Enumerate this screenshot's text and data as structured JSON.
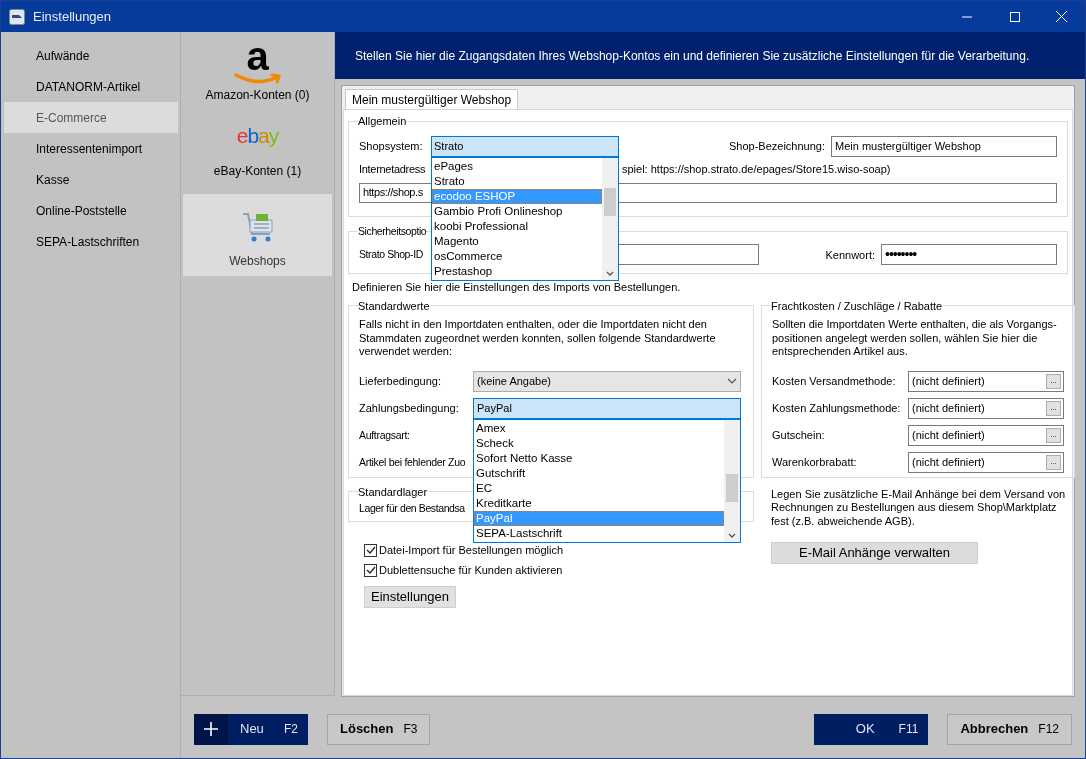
{
  "window": {
    "title": "Einstellungen"
  },
  "sidebar": {
    "items": [
      {
        "label": "Aufwände",
        "selected": false
      },
      {
        "label": "DATANORM-Artikel",
        "selected": false
      },
      {
        "label": "E-Commerce",
        "selected": true
      },
      {
        "label": "Interessentenimport",
        "selected": false
      },
      {
        "label": "Kasse",
        "selected": false
      },
      {
        "label": "Online-Poststelle",
        "selected": false
      },
      {
        "label": "SEPA-Lastschriften",
        "selected": false
      }
    ]
  },
  "accounts": [
    {
      "kind": "amazon",
      "logo": "a",
      "label": "Amazon-Konten (0)",
      "selected": false
    },
    {
      "kind": "ebay",
      "logo": "ebay",
      "label": "eBay-Konten (1)",
      "selected": false
    },
    {
      "kind": "webshop",
      "label": "Webshops",
      "selected": true
    }
  ],
  "header": "Stellen Sie hier die Zugangsdaten Ihres Webshop-Kontos ein und definieren Sie zusätzliche Einstellungen für die Verarbeitung.",
  "tabs": [
    {
      "label": "Mein mustergültiger Webshop",
      "selected": true
    }
  ],
  "general": {
    "legend": "Allgemein",
    "shopsystem_label": "Shopsystem:",
    "shopsystem_value": "Strato",
    "shopsystem_options": [
      {
        "label": "ePages",
        "selected": false
      },
      {
        "label": "Strato",
        "selected": false
      },
      {
        "label": "ecodoo ESHOP",
        "selected": true
      },
      {
        "label": "Gambio Profi Onlineshop",
        "selected": false
      },
      {
        "label": "koobi Professional",
        "selected": false
      },
      {
        "label": "Magento",
        "selected": false
      },
      {
        "label": "osCommerce",
        "selected": false
      },
      {
        "label": "Prestashop",
        "selected": false
      }
    ],
    "name_label": "Shop-Bezeichnung:",
    "name_value": "Mein mustergültiger Webshop",
    "url_label": "Internetadress",
    "url_hint": "spiel: https://shop.strato.de/epages/Store15.wiso-soap)",
    "url_value": "https://shop.s"
  },
  "security": {
    "legend": "Sicherheitsoptio",
    "id_label": "Strato Shop-ID",
    "password_label": "Kennwort:",
    "password_mask": "••••••••"
  },
  "import_note": "Definieren Sie hier die Einstellungen des Imports von Bestellungen.",
  "defaults": {
    "legend": "Standardwerte",
    "description": "Falls nicht in den Importdaten enthalten, oder die Importdaten nicht den Stammdaten zugeordnet werden konnten, sollen folgende Standardwerte verwendet werden:",
    "rows": [
      {
        "kind": "select",
        "label": "Lieferbedingung:",
        "value": "(keine Angabe)"
      },
      {
        "kind": "dropdown",
        "label": "Zahlungsbedingung:",
        "value": "PayPal",
        "options": [
          {
            "label": "Amex",
            "selected": false
          },
          {
            "label": "Scheck",
            "selected": false
          },
          {
            "label": "Sofort Netto Kasse",
            "selected": false
          },
          {
            "label": "Gutschrift",
            "selected": false
          },
          {
            "label": "EC",
            "selected": false
          },
          {
            "label": "Kreditkarte",
            "selected": false
          },
          {
            "label": "PayPal",
            "selected": true
          },
          {
            "label": "SEPA-Lastschrift",
            "selected": false
          }
        ]
      },
      {
        "kind": "label",
        "label": "Auftragsart:"
      },
      {
        "kind": "label",
        "label": "Artikel bei fehlender Zuo"
      }
    ]
  },
  "warehouse": {
    "legend": "Standardlager",
    "text": "Lager für den Bestandsa"
  },
  "checkboxes": [
    {
      "label": "Datei-Import für Bestellungen möglich",
      "checked": true
    },
    {
      "label": "Dublettensuche für Kunden aktivieren",
      "checked": true
    }
  ],
  "settings_button": "Einstellungen",
  "costs": {
    "legend": "Frachtkosten / Zuschläge / Rabatte",
    "description": "Sollten die Importdaten Werte enthalten, die als Vorgangs-positionen angelegt werden sollen, wählen Sie hier die entsprechenden Artikel aus.",
    "rows": [
      {
        "label": "Kosten Versandmethode:",
        "value": "(nicht definiert)",
        "button": "..."
      },
      {
        "label": "Kosten Zahlungsmethode:",
        "value": "(nicht definiert)",
        "button": "..."
      },
      {
        "label": "Gutschein:",
        "value": "(nicht definiert)",
        "button": "..."
      },
      {
        "label": "Warenkorbrabatt:",
        "value": "(nicht definiert)",
        "button": "..."
      }
    ]
  },
  "attachments": {
    "text": "Legen Sie zusätzliche E-Mail Anhänge bei dem Versand von Rechnungen zu Bestellungen aus diesem Shop\\Marktplatz fest (z.B. abweichende AGB).",
    "button": "E-Mail Anhänge verwalten"
  },
  "footer_buttons": [
    {
      "kind": "add",
      "label": "Neu",
      "key": "F2"
    },
    {
      "kind": "secondary",
      "label": "Löschen",
      "key": "F3"
    },
    {
      "kind": "primary",
      "label": "OK",
      "key": "F11"
    },
    {
      "kind": "secondary",
      "label": "Abbrechen",
      "key": "F12"
    }
  ]
}
